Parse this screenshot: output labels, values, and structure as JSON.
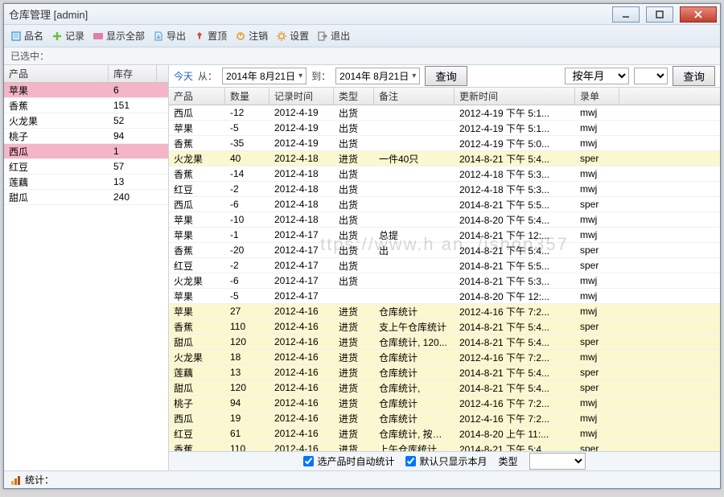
{
  "window": {
    "title": "仓库管理 [admin]"
  },
  "toolbar": {
    "items": [
      {
        "icon": "name-icon",
        "text": "品名",
        "color": "#4aa3df"
      },
      {
        "icon": "plus-icon",
        "text": "记录",
        "color": "#6bbf3a"
      },
      {
        "icon": "display-icon",
        "text": "显示全部",
        "color": "#e07faa"
      },
      {
        "icon": "export-icon",
        "text": "导出",
        "color": "#6aa8e0"
      },
      {
        "icon": "pin-icon",
        "text": "置顶",
        "color": "#d04a3a"
      },
      {
        "icon": "logout-icon",
        "text": "注销",
        "color": "#e2a43a"
      },
      {
        "icon": "settings-icon",
        "text": "设置",
        "color": "#e2a43a"
      },
      {
        "icon": "exit-icon",
        "text": "退出",
        "color": "#888"
      }
    ]
  },
  "selection": {
    "label": "已选中："
  },
  "filter": {
    "today": "今天",
    "from_label": "从：",
    "from_date": "2014年 8月21日",
    "to_label": "到：",
    "to_date": "2014年 8月21日",
    "query": "查询",
    "by_yearmonth": "按年月",
    "query2": "查询"
  },
  "left": {
    "headers": [
      "产品",
      "库存"
    ],
    "rows": [
      {
        "p": "苹果",
        "s": "6",
        "pink": true
      },
      {
        "p": "香蕉",
        "s": "151"
      },
      {
        "p": "火龙果",
        "s": "52"
      },
      {
        "p": "桃子",
        "s": "94"
      },
      {
        "p": "西瓜",
        "s": "1",
        "pink": true
      },
      {
        "p": "红豆",
        "s": "57"
      },
      {
        "p": "莲藕",
        "s": "13"
      },
      {
        "p": "甜瓜",
        "s": "240"
      }
    ]
  },
  "right": {
    "headers": [
      "产品",
      "数量",
      "记录时间",
      "类型",
      "备注",
      "更新时间",
      "录单"
    ],
    "rows": [
      {
        "c": [
          "西瓜",
          "-12",
          "2012-4-19",
          "出货",
          "",
          "2012-4-19 下午 5:1...",
          "mwj"
        ]
      },
      {
        "c": [
          "苹果",
          "-5",
          "2012-4-19",
          "出货",
          "",
          "2012-4-19 下午 5:1...",
          "mwj"
        ]
      },
      {
        "c": [
          "香蕉",
          "-35",
          "2012-4-19",
          "出货",
          "",
          "2012-4-19 下午 5:0...",
          "mwj"
        ]
      },
      {
        "c": [
          "火龙果",
          "40",
          "2012-4-18",
          "进货",
          "一件40只",
          "2014-8-21 下午 5:4...",
          "sper"
        ],
        "y": true
      },
      {
        "c": [
          "香蕉",
          "-14",
          "2012-4-18",
          "出货",
          "",
          "2012-4-18 下午 5:3...",
          "mwj"
        ]
      },
      {
        "c": [
          "红豆",
          "-2",
          "2012-4-18",
          "出货",
          "",
          "2012-4-18 下午 5:3...",
          "mwj"
        ]
      },
      {
        "c": [
          "西瓜",
          "-6",
          "2012-4-18",
          "出货",
          "",
          "2014-8-21 下午 5:5...",
          "sper"
        ]
      },
      {
        "c": [
          "苹果",
          "-10",
          "2012-4-18",
          "出货",
          "",
          "2014-8-20 下午 5:4...",
          "mwj"
        ]
      },
      {
        "c": [
          "苹果",
          "-1",
          "2012-4-17",
          "出货",
          "总提",
          "2014-8-21 下午 12:...",
          "mwj"
        ]
      },
      {
        "c": [
          "香蕉",
          "-20",
          "2012-4-17",
          "出货",
          "出",
          "2014-8-21 下午 5:4...",
          "sper"
        ]
      },
      {
        "c": [
          "红豆",
          "-2",
          "2012-4-17",
          "出货",
          "",
          "2014-8-21 下午 5:5...",
          "sper"
        ]
      },
      {
        "c": [
          "火龙果",
          "-6",
          "2012-4-17",
          "出货",
          "",
          "2014-8-21 下午 5:3...",
          "mwj"
        ]
      },
      {
        "c": [
          "苹果",
          "-5",
          "2012-4-17",
          "",
          "",
          "2014-8-20 下午 12:...",
          "mwj"
        ]
      },
      {
        "c": [
          "苹果",
          "27",
          "2012-4-16",
          "进货",
          "仓库统计",
          "2012-4-16 下午 7:2...",
          "mwj"
        ],
        "y": true
      },
      {
        "c": [
          "香蕉",
          "110",
          "2012-4-16",
          "进货",
          "支上午仓库统计",
          "2014-8-21 下午 5:4...",
          "sper"
        ],
        "y": true
      },
      {
        "c": [
          "甜瓜",
          "120",
          "2012-4-16",
          "进货",
          "仓库统计, 120...",
          "2014-8-21 下午 5:4...",
          "sper"
        ],
        "y": true
      },
      {
        "c": [
          "火龙果",
          "18",
          "2012-4-16",
          "进货",
          "仓库统计",
          "2012-4-16 下午 7:2...",
          "mwj"
        ],
        "y": true
      },
      {
        "c": [
          "莲藕",
          "13",
          "2012-4-16",
          "进货",
          "仓库统计",
          "2014-8-21 下午 5:4...",
          "sper"
        ],
        "y": true
      },
      {
        "c": [
          "甜瓜",
          "120",
          "2012-4-16",
          "进货",
          "仓库统计,",
          "2014-8-21 下午 5:4...",
          "sper"
        ],
        "y": true
      },
      {
        "c": [
          "桃子",
          "94",
          "2012-4-16",
          "进货",
          "仓库统计",
          "2012-4-16 下午 7:2...",
          "mwj"
        ],
        "y": true
      },
      {
        "c": [
          "西瓜",
          "19",
          "2012-4-16",
          "进货",
          "仓库统计",
          "2012-4-16 下午 7:2...",
          "mwj"
        ],
        "y": true
      },
      {
        "c": [
          "红豆",
          "61",
          "2012-4-16",
          "进货",
          "仓库统计, 按小盒",
          "2014-8-20 上午 11:...",
          "mwj"
        ],
        "y": true
      },
      {
        "c": [
          "香蕉",
          "110",
          "2012-4-16",
          "进货",
          "上午仓库统计",
          "2014-8-21 下午 5:4...",
          "sper"
        ],
        "y": true
      }
    ]
  },
  "bottom": {
    "cb1": "选产品时自动统计",
    "cb2": "默认只显示本月",
    "type_label": "类型"
  },
  "status": {
    "label": "统计："
  },
  "watermark": "ttps://www.h       an.     /jshop357"
}
